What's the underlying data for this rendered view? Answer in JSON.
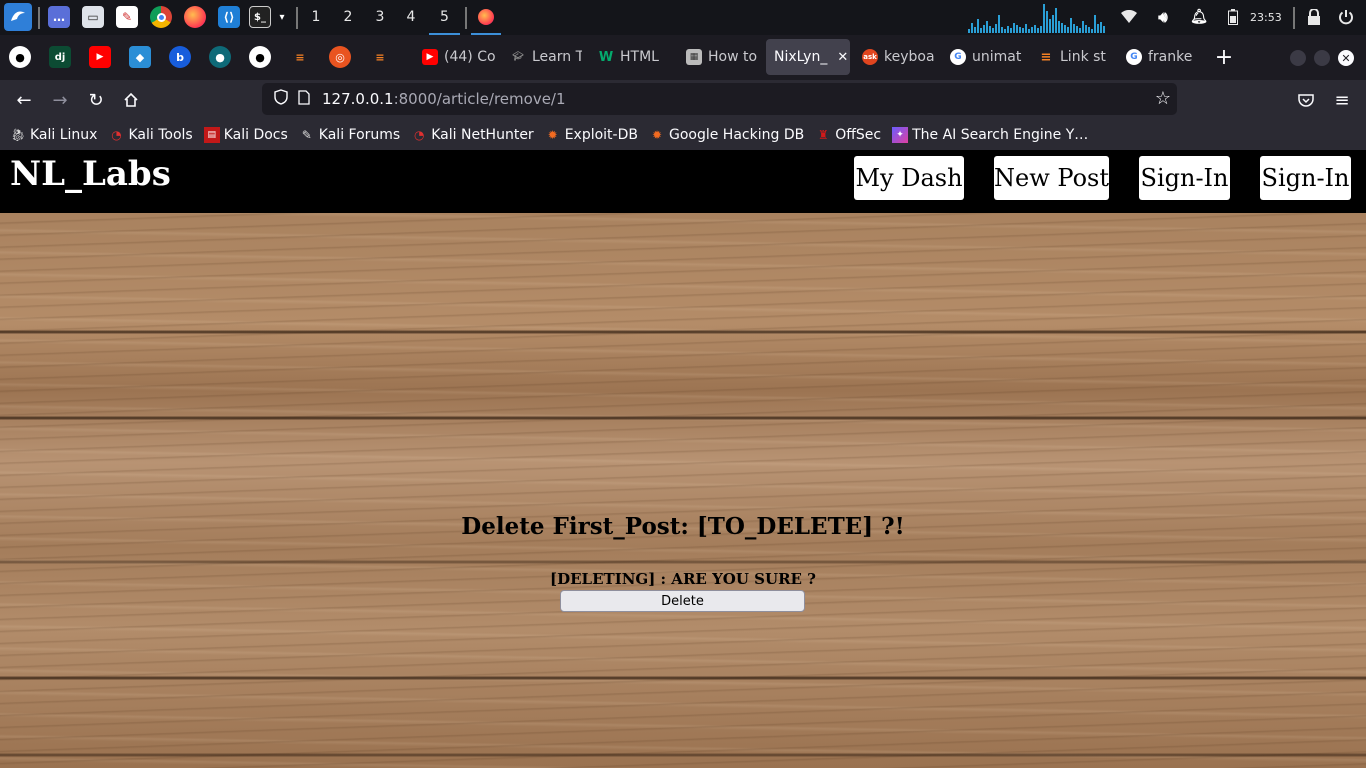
{
  "taskbar": {
    "workspaces": [
      "1",
      "2",
      "3",
      "4",
      "5"
    ],
    "active_workspace": "5",
    "clock": "23:53",
    "accent": "#3c8fd9"
  },
  "browser": {
    "tabs": [
      {
        "label": "(44) Co",
        "icon": "youtube-icon"
      },
      {
        "label": "Learn T",
        "icon": "graduation-cap-icon"
      },
      {
        "label": "HTML",
        "icon": "w3-icon"
      },
      {
        "label": "How to",
        "icon": "image-icon"
      },
      {
        "label": "NixLyn_",
        "icon": "",
        "active": true
      },
      {
        "label": "keyboa",
        "icon": "ask-icon"
      },
      {
        "label": "unimat",
        "icon": "google-icon"
      },
      {
        "label": "Link st",
        "icon": "stackoverflow-icon"
      },
      {
        "label": "franke",
        "icon": "google-icon"
      }
    ],
    "url": {
      "host": "127.0.0.1",
      "path": ":8000/article/remove/1"
    },
    "bookmarks": [
      {
        "label": "Kali Linux",
        "icon": "kali-dragon-icon"
      },
      {
        "label": "Kali Tools",
        "icon": "kali-tools-icon"
      },
      {
        "label": "Kali Docs",
        "icon": "kali-docs-icon"
      },
      {
        "label": "Kali Forums",
        "icon": "kali-forums-icon"
      },
      {
        "label": "Kali NetHunter",
        "icon": "nethunter-icon"
      },
      {
        "label": "Exploit-DB",
        "icon": "exploit-db-icon"
      },
      {
        "label": "Google Hacking DB",
        "icon": "ghdb-icon"
      },
      {
        "label": "OffSec",
        "icon": "offsec-icon"
      },
      {
        "label": "The AI Search Engine Y…",
        "icon": "ai-search-icon"
      }
    ]
  },
  "site": {
    "title": "NL_Labs",
    "nav": {
      "my_dash": "My Dash",
      "new_post": "New Post",
      "sign_in_1": "Sign-In",
      "sign_in_2": "Sign-In"
    }
  },
  "main": {
    "heading": "Delete First_Post: [TO_DELETE] ?!",
    "confirm_text": "[DELETING] : ARE YOU SURE ?",
    "delete_label": "Delete"
  }
}
